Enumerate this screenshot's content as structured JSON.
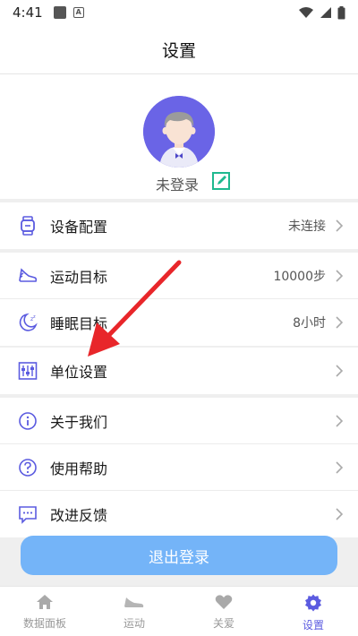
{
  "status_bar": {
    "time": "4:41",
    "a_glyph": "A"
  },
  "header": {
    "title": "设置"
  },
  "profile": {
    "login_text": "未登录"
  },
  "device_section": [
    {
      "label": "设备配置",
      "value": "未连接",
      "icon": "watch-icon"
    }
  ],
  "goals_section": [
    {
      "label": "运动目标",
      "value": "10000步",
      "icon": "sneaker-icon"
    },
    {
      "label": "睡眠目标",
      "value": "8小时",
      "icon": "moon-icon"
    }
  ],
  "unit_section": [
    {
      "label": "单位设置",
      "value": "",
      "icon": "sliders-icon"
    }
  ],
  "info_section": [
    {
      "label": "关于我们",
      "value": "",
      "icon": "info-icon"
    },
    {
      "label": "使用帮助",
      "value": "",
      "icon": "help-icon"
    },
    {
      "label": "改进反馈",
      "value": "",
      "icon": "feedback-icon"
    }
  ],
  "logout": {
    "label": "退出登录"
  },
  "tabbar": [
    {
      "label": "数据面板",
      "icon": "home-icon",
      "active": false
    },
    {
      "label": "运动",
      "icon": "shoe-icon",
      "active": false
    },
    {
      "label": "关爱",
      "icon": "heart-icon",
      "active": false
    },
    {
      "label": "设置",
      "icon": "gear-icon",
      "active": true
    }
  ],
  "colors": {
    "accent": "#5b5be0",
    "button": "#74b4f8",
    "annotation_arrow": "#e8262a"
  }
}
